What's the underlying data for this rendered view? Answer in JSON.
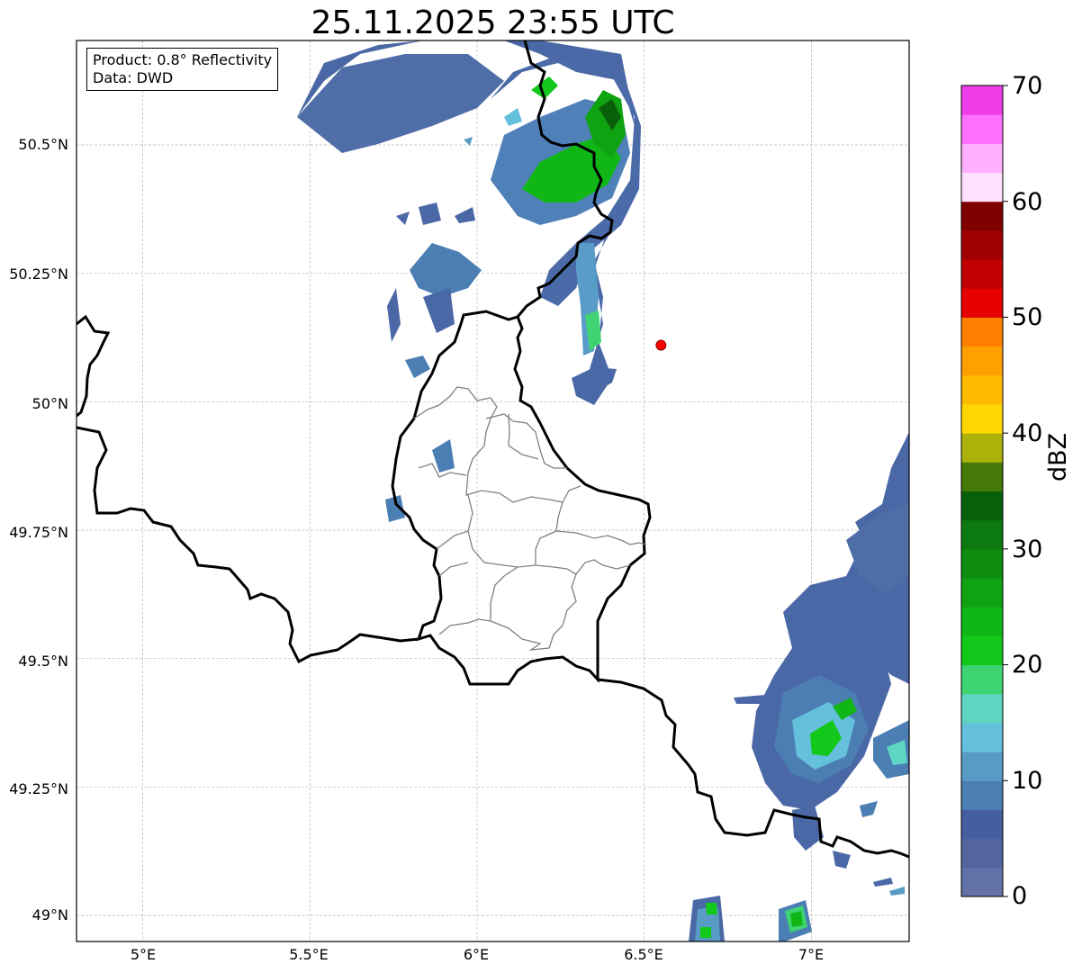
{
  "title": "25.11.2025 23:55 UTC",
  "info": {
    "product": "Product: 0.8° Reflectivity",
    "source": "Data: DWD"
  },
  "axes": {
    "y_ticks": [
      "50.5°N",
      "50.25°N",
      "50°N",
      "49.75°N",
      "49.5°N",
      "49.25°N",
      "49°N"
    ],
    "x_ticks": [
      "5°E",
      "5.5°E",
      "6°E",
      "6.5°E",
      "7°E"
    ],
    "lon_range": [
      4.8,
      7.3
    ],
    "lat_range": [
      48.95,
      50.7
    ],
    "grid": true
  },
  "colorbar": {
    "unit": "dBZ",
    "tick_labels": [
      "70",
      "60",
      "50",
      "40",
      "30",
      "20",
      "10",
      "0"
    ],
    "range": [
      0,
      70
    ],
    "colors": [
      "#6272a6",
      "#5366a0",
      "#445e9e",
      "#4b7eb3",
      "#589cc6",
      "#65c0db",
      "#5dd5c2",
      "#3fd473",
      "#12c81a",
      "#10b616",
      "#0fa211",
      "#0e8c10",
      "#0c7a0e",
      "#08600a",
      "#45790a",
      "#abb20a",
      "#ffd700",
      "#ffbb00",
      "#ff9f00",
      "#ff8000",
      "#e60000",
      "#c00000",
      "#a00000",
      "#800000",
      "#ffe0ff",
      "#ffb0ff",
      "#ff70ff",
      "#ee3ce8"
    ]
  },
  "marker": {
    "lon": 6.55,
    "lat": 50.11,
    "color": "#ff0000"
  }
}
